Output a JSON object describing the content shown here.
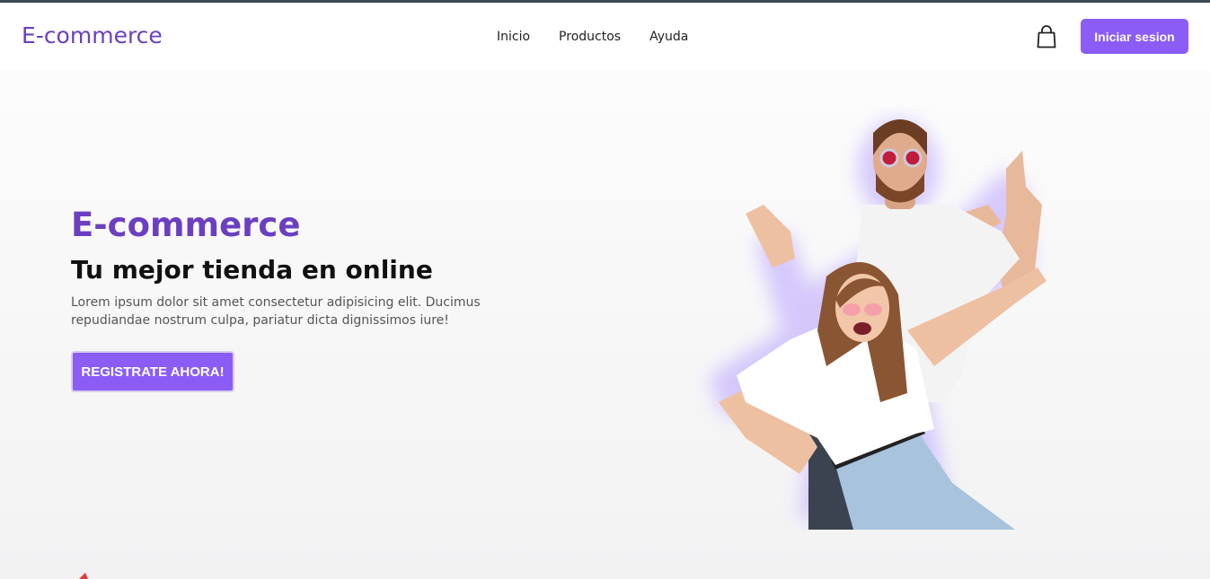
{
  "header": {
    "logo": "E-commerce",
    "nav": [
      "Inicio",
      "Productos",
      "Ayuda"
    ],
    "bag_icon": "shopping-bag-icon",
    "login_label": "Iniciar sesion"
  },
  "hero": {
    "title": "E-commerce",
    "subtitle": "Tu mejor tienda en online",
    "text": "Lorem ipsum dolor sit amet consectetur adipisicing elit. Ducimus repudiandae nostrum culpa, pariatur dicta dignissimos iure!",
    "cta_label": "REGISTRATE AHORA!"
  },
  "colors": {
    "brand": "#6b3fc0",
    "accent": "#8b5cf6"
  }
}
